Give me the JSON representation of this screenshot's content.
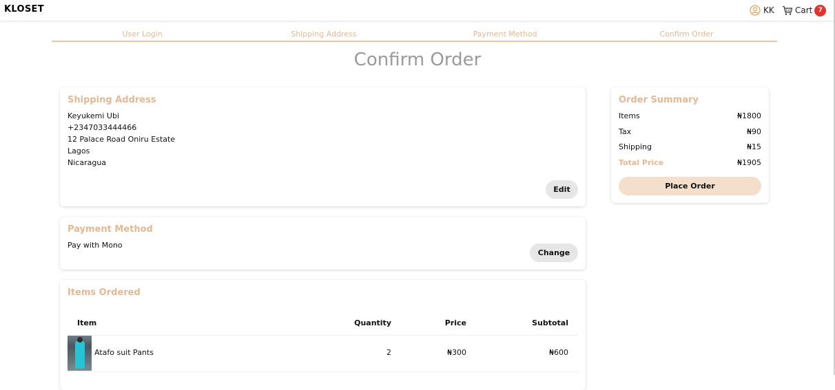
{
  "header": {
    "brand": "KLOSET",
    "user_initials": "KK",
    "cart_label": "Cart",
    "cart_count": "7"
  },
  "steps": [
    "User Login",
    "Shipping Address",
    "Payment Method",
    "Confirm Order"
  ],
  "page_title": "Confirm Order",
  "shipping": {
    "title": "Shipping Address",
    "name": "Keyukemi Ubi",
    "phone": "+2347033444466",
    "street": "12 Palace Road Oniru Estate",
    "city": "Lagos",
    "country": "Nicaragua",
    "edit_label": "Edit"
  },
  "payment": {
    "title": "Payment Method",
    "method": "Pay with Mono",
    "change_label": "Change"
  },
  "items": {
    "title": "Items Ordered",
    "columns": {
      "item": "Item",
      "quantity": "Quantity",
      "price": "Price",
      "subtotal": "Subtotal"
    },
    "rows": [
      {
        "name": "Atafo suit Pants",
        "quantity": "2",
        "price": "₦300",
        "subtotal": "₦600"
      }
    ]
  },
  "summary": {
    "title": "Order Summary",
    "items_label": "Items",
    "items_value": "₦1800",
    "tax_label": "Tax",
    "tax_value": "₦90",
    "shipping_label": "Shipping",
    "shipping_value": "₦15",
    "total_label": "Total Price",
    "total_value": "₦1905",
    "place_order_label": "Place Order"
  },
  "colors": {
    "accent": "#e2b995",
    "badge": "#e5322d",
    "button_light": "#f4dfcc"
  }
}
